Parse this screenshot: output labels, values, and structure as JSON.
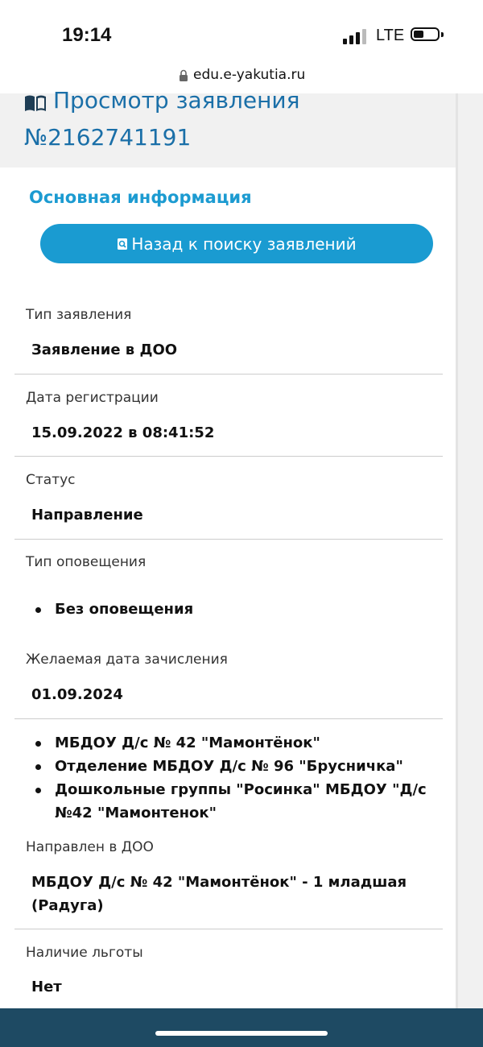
{
  "status_bar": {
    "time": "19:14",
    "network": "LTE"
  },
  "browser": {
    "url": "edu.e-yakutia.ru"
  },
  "header": {
    "title_line1": "Просмотр заявления",
    "title_line2": "№2162741191"
  },
  "main": {
    "section_title": "Основная информация",
    "back_button_label": "Назад к поиску заявлений",
    "fields": [
      {
        "label": "Тип заявления",
        "value": "Заявление в ДОО"
      },
      {
        "label": "Дата регистрации",
        "value": "15.09.2022 в 08:41:52"
      },
      {
        "label": "Статус",
        "value": "Направление"
      },
      {
        "label": "Тип оповещения",
        "list": [
          "Без оповещения"
        ]
      },
      {
        "label": "Желаемая дата зачисления",
        "value": "01.09.2024"
      }
    ],
    "preferred_doo": [
      "МБДОУ Д/с № 42 \"Мамонтёнок\"",
      "Отделение МБДОУ Д/с № 96 \"Брусничка\"",
      "Дошкольные группы \"Росинка\" МБДОУ \"Д/с №42 \"Мамонтенок\""
    ],
    "assigned": {
      "label": "Направлен в ДОО",
      "value": "МБДОУ Д/с № 42 \"Мамонтёнок\" - 1 младшая (Радуга)"
    },
    "benefit": {
      "label": "Наличие льготы",
      "value": "Нет"
    }
  },
  "colors": {
    "accent": "#1a9bd1",
    "title": "#1a6fa8",
    "header_bg": "#f1f1f1",
    "home_bar": "#1e4a63"
  }
}
